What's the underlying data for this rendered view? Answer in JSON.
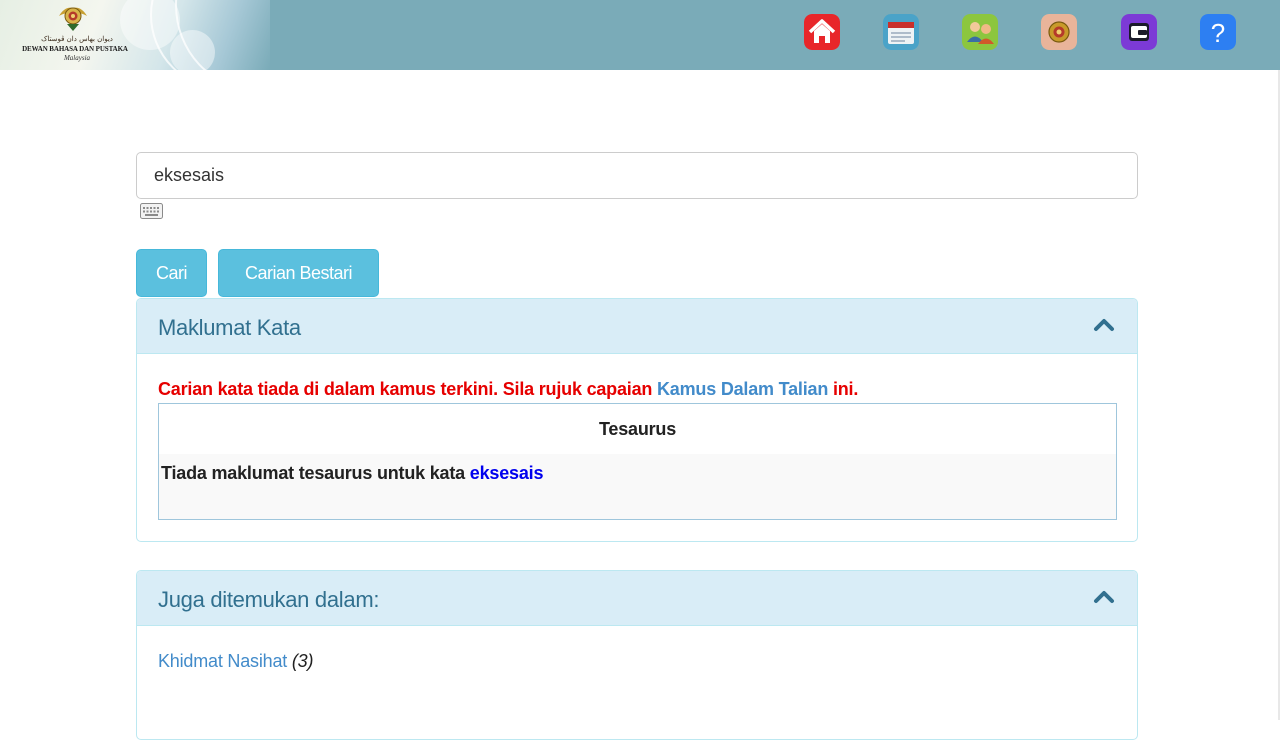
{
  "header": {
    "logo": {
      "jawi_text": "ديوان بهاس دان ڤوستاک",
      "name": "DEWAN BAHASA DAN PUSTAKA",
      "country": "Malaysia"
    },
    "nav_icons": [
      {
        "name": "home-icon",
        "color": "#e8262a"
      },
      {
        "name": "calendar-icon",
        "color": "#4aa3c8"
      },
      {
        "name": "users-icon",
        "color": "#8cc63e"
      },
      {
        "name": "emblem-icon",
        "color": "#e9b49a"
      },
      {
        "name": "wallet-icon",
        "color": "#7c3ad6"
      },
      {
        "name": "help-icon",
        "color": "#2d7ff2"
      }
    ]
  },
  "search": {
    "value": "eksesais",
    "keyboard_icon": "keyboard-icon"
  },
  "buttons": {
    "cari": "Cari",
    "carian_bestari": "Carian Bestari"
  },
  "panel_maklumat": {
    "title": "Maklumat Kata",
    "notice_before": "Carian kata tiada di dalam kamus terkini. Sila rujuk capaian ",
    "notice_link": "Kamus Dalam Talian",
    "notice_after": " ini.",
    "tesaurus": {
      "heading": "Tesaurus",
      "text": "Tiada maklumat tesaurus untuk kata ",
      "word": "eksesais"
    }
  },
  "panel_juga": {
    "title": "Juga ditemukan dalam:",
    "items": [
      {
        "label": "Khidmat Nasihat",
        "count": "(3)"
      }
    ]
  },
  "colors": {
    "header_bg": "#7aabb8",
    "button_bg": "#5bc0de",
    "panel_heading_bg": "#d9edf7",
    "panel_title": "#31708f",
    "notice_red": "#e60000",
    "link_blue": "#428bca"
  }
}
